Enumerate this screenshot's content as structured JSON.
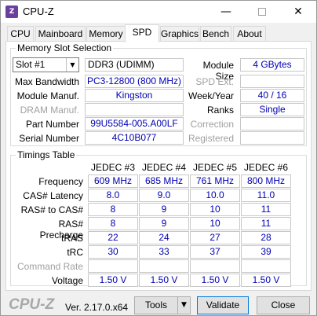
{
  "window": {
    "title": "CPU-Z",
    "icon": "cpu-z-app-icon",
    "controls": {
      "minimize": "—",
      "close": "✕"
    }
  },
  "tabs": [
    {
      "label": "CPU",
      "active": false
    },
    {
      "label": "Mainboard",
      "active": false
    },
    {
      "label": "Memory",
      "active": false
    },
    {
      "label": "SPD",
      "active": true
    },
    {
      "label": "Graphics",
      "active": false
    },
    {
      "label": "Bench",
      "active": false
    },
    {
      "label": "About",
      "active": false
    }
  ],
  "slot_selection": {
    "title": "Memory Slot Selection",
    "slot": "Slot #1",
    "memory_type": "DDR3 (UDIMM)",
    "module_size_label": "Module Size",
    "module_size": "4 GBytes",
    "max_bandwidth_label": "Max Bandwidth",
    "max_bandwidth": "PC3-12800 (800 MHz)",
    "spd_ext_label": "SPD Ext.",
    "spd_ext": "",
    "module_manuf_label": "Module Manuf.",
    "module_manuf": "Kingston",
    "week_year_label": "Week/Year",
    "week_year": "40 / 16",
    "dram_manuf_label": "DRAM Manuf.",
    "dram_manuf": "",
    "ranks_label": "Ranks",
    "ranks": "Single",
    "part_number_label": "Part Number",
    "part_number": "99U5584-005.A00LF",
    "correction_label": "Correction",
    "correction": "",
    "serial_number_label": "Serial Number",
    "serial_number": "4C10B077",
    "registered_label": "Registered",
    "registered": ""
  },
  "timings": {
    "title": "Timings Table",
    "columns": [
      "JEDEC #3",
      "JEDEC #4",
      "JEDEC #5",
      "JEDEC #6"
    ],
    "rows": [
      {
        "label": "Frequency",
        "dim": false,
        "values": [
          "609 MHz",
          "685 MHz",
          "761 MHz",
          "800 MHz"
        ]
      },
      {
        "label": "CAS# Latency",
        "dim": false,
        "values": [
          "8.0",
          "9.0",
          "10.0",
          "11.0"
        ]
      },
      {
        "label": "RAS# to CAS#",
        "dim": false,
        "values": [
          "8",
          "9",
          "10",
          "11"
        ]
      },
      {
        "label": "RAS# Precharge",
        "dim": false,
        "values": [
          "8",
          "9",
          "10",
          "11"
        ]
      },
      {
        "label": "tRAS",
        "dim": false,
        "values": [
          "22",
          "24",
          "27",
          "28"
        ]
      },
      {
        "label": "tRC",
        "dim": false,
        "values": [
          "30",
          "33",
          "37",
          "39"
        ]
      },
      {
        "label": "Command Rate",
        "dim": true,
        "values": [
          "",
          "",
          "",
          ""
        ]
      },
      {
        "label": "Voltage",
        "dim": false,
        "values": [
          "1.50 V",
          "1.50 V",
          "1.50 V",
          "1.50 V"
        ]
      }
    ]
  },
  "footer": {
    "brand": "CPU-Z",
    "version": "Ver. 2.17.0.x64",
    "tools_label": "Tools",
    "validate_label": "Validate",
    "close_label": "Close"
  },
  "colors": {
    "value_text": "#0000b4",
    "dim_label": "#a0a0a0",
    "brand_gray": "#a8a8a8",
    "focus_border": "#0078d7"
  }
}
